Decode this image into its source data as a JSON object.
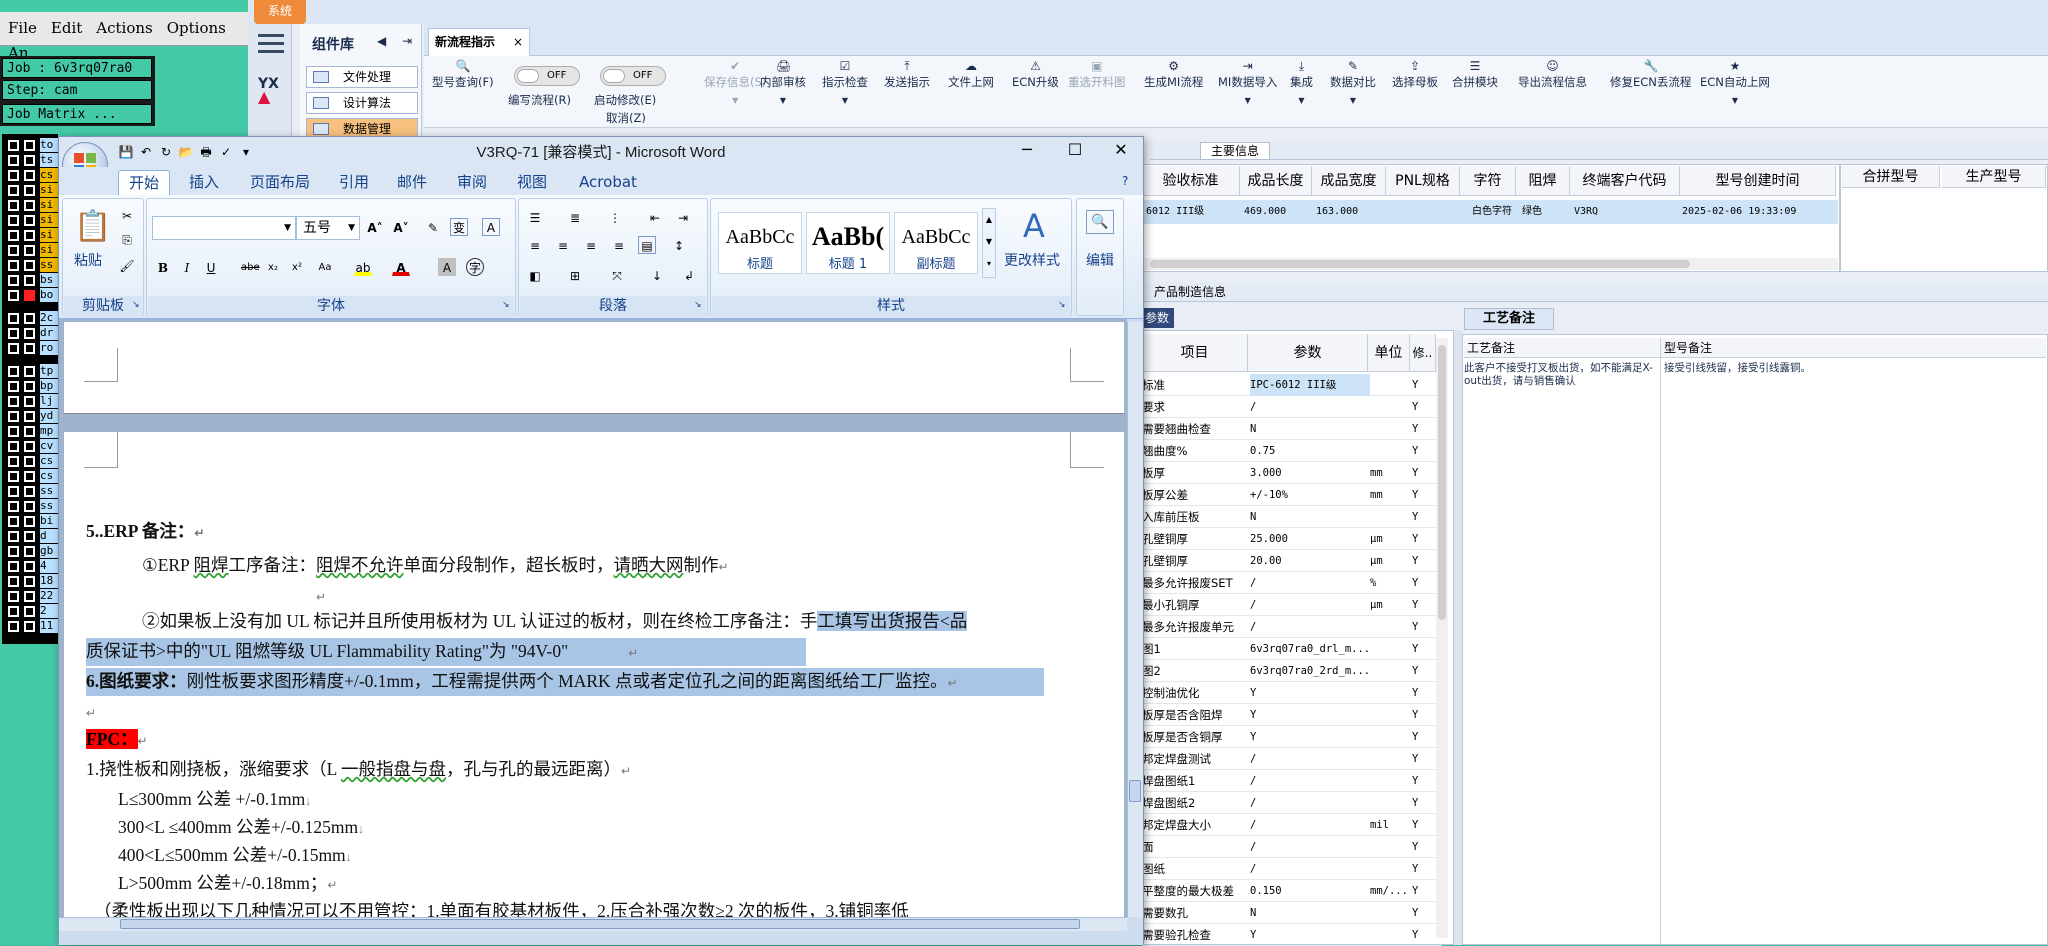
{
  "cam": {
    "menu": [
      "File",
      "Edit",
      "Actions",
      "Options",
      "An"
    ],
    "job_label": "Job : 6v3rq07ra0",
    "step_label": "Step: cam",
    "matrix_button": "Job Matrix ...",
    "layers": [
      {
        "name": "to",
        "color": "#b8e0ff"
      },
      {
        "name": "ts",
        "color": "#b8e0ff"
      },
      {
        "name": "cs",
        "color": "#f0b800"
      },
      {
        "name": "si",
        "color": "#f0b800"
      },
      {
        "name": "si",
        "color": "#f0b800"
      },
      {
        "name": "si",
        "color": "#f0b800"
      },
      {
        "name": "si",
        "color": "#f0b800"
      },
      {
        "name": "si",
        "color": "#f0b800"
      },
      {
        "name": "ss",
        "color": "#f0b800"
      },
      {
        "name": "bs",
        "color": "#b8e0ff"
      },
      {
        "name": "bo",
        "color": "#b8e0ff"
      },
      {
        "name": "2c",
        "color": "#b8e0ff"
      },
      {
        "name": "dr",
        "color": "#b8e0ff"
      },
      {
        "name": "ro",
        "color": "#b8e0ff"
      },
      {
        "name": "tp",
        "color": "#b8e0ff"
      },
      {
        "name": "bp",
        "color": "#b8e0ff"
      },
      {
        "name": "lj",
        "color": "#b8e0ff"
      },
      {
        "name": "yd",
        "color": "#b8e0ff"
      },
      {
        "name": "mp",
        "color": "#b8e0ff"
      },
      {
        "name": "cv",
        "color": "#b8e0ff"
      },
      {
        "name": "cs",
        "color": "#b8e0ff"
      },
      {
        "name": "cs",
        "color": "#b8e0ff"
      },
      {
        "name": "ss",
        "color": "#b8e0ff"
      },
      {
        "name": "ss",
        "color": "#b8e0ff"
      },
      {
        "name": "bi",
        "color": "#b8e0ff"
      },
      {
        "name": "d",
        "color": "#b8e0ff"
      },
      {
        "name": "gb",
        "color": "#b8e0ff"
      },
      {
        "name": "4",
        "color": "#b8e0ff"
      },
      {
        "name": "18",
        "color": "#b8e0ff"
      },
      {
        "name": "22",
        "color": "#b8e0ff"
      },
      {
        "name": "2",
        "color": "#b8e0ff"
      },
      {
        "name": "11",
        "color": "#b8e0ff"
      }
    ]
  },
  "sys": {
    "system_tab": "系统",
    "component_library": "组件库",
    "components": [
      "文件处理",
      "设计算法",
      "数据管理"
    ],
    "doc_tab": "新流程指示",
    "toolbar": [
      {
        "label": "型号查询(F)",
        "icon": "🔍",
        "dropdown": false,
        "disabled": false
      },
      {
        "label": "保存信息(S)",
        "icon": "✔",
        "dropdown": true,
        "disabled": true
      },
      {
        "label": "内部审核",
        "icon": "🖨",
        "dropdown": true,
        "disabled": false
      },
      {
        "label": "指示检查",
        "icon": "☑",
        "dropdown": true,
        "disabled": false
      },
      {
        "label": "发送指示",
        "icon": "⤒",
        "dropdown": false,
        "disabled": false
      },
      {
        "label": "文件上网",
        "icon": "☁",
        "dropdown": false,
        "disabled": false
      },
      {
        "label": "ECN升级",
        "icon": "⚠",
        "dropdown": false,
        "disabled": false
      },
      {
        "label": "重选开料图",
        "icon": "▣",
        "dropdown": false,
        "disabled": true
      },
      {
        "label": "生成MI流程",
        "icon": "⚙",
        "dropdown": false,
        "disabled": false
      },
      {
        "label": "MI数据导入",
        "icon": "⇥",
        "dropdown": true,
        "disabled": false
      },
      {
        "label": "集成",
        "icon": "⤓",
        "dropdown": true,
        "disabled": false
      },
      {
        "label": "数据对比",
        "icon": "✎",
        "dropdown": true,
        "disabled": false
      },
      {
        "label": "选择母板",
        "icon": "⇪",
        "dropdown": false,
        "disabled": false
      },
      {
        "label": "合拼模块",
        "icon": "☰",
        "dropdown": false,
        "disabled": false
      },
      {
        "label": "导出流程信息",
        "icon": "☺",
        "dropdown": false,
        "disabled": false
      },
      {
        "label": "修复ECN丢流程",
        "icon": "🔧",
        "dropdown": false,
        "disabled": false
      },
      {
        "label": "ECN自动上网",
        "icon": "★",
        "dropdown": true,
        "disabled": false
      }
    ],
    "toggle1": {
      "state": "OFF",
      "label": "编写流程(R)"
    },
    "toggle2": {
      "state": "OFF",
      "label": "启动修改(E)",
      "sublabel": "取消(Z)"
    },
    "main_info_tab": "主要信息",
    "main_headers": [
      "验收标准",
      "成品长度",
      "成品宽度",
      "PNL规格",
      "字符",
      "阻焊",
      "终端客户代码",
      "型号创建时间"
    ],
    "main_row": [
      "6012 III级",
      "469.000",
      "163.000",
      "",
      "白色字符",
      "绿色",
      "V3RQ",
      "2025-02-06 19:33:09"
    ],
    "right_headers": [
      "合拼型号",
      "生产型号"
    ],
    "section_title": "产品制造信息",
    "param_tab": "参数",
    "param_headers": [
      "项目",
      "参数",
      "单位",
      "修.."
    ],
    "params": [
      [
        "标准",
        "IPC-6012 III级",
        "",
        "Y"
      ],
      [
        "要求",
        "/",
        "",
        "Y"
      ],
      [
        "需要翘曲检查",
        "N",
        "",
        "Y"
      ],
      [
        "翘曲度%",
        "0.75",
        "",
        "Y"
      ],
      [
        "板厚",
        "3.000",
        "mm",
        "Y"
      ],
      [
        "板厚公差",
        "+/-10%",
        "mm",
        "Y"
      ],
      [
        "入库前压板",
        "N",
        "",
        "Y"
      ],
      [
        "孔壁铜厚",
        "25.000",
        "μm",
        "Y"
      ],
      [
        "孔壁铜厚",
        "20.00",
        "μm",
        "Y"
      ],
      [
        "最多允许报废SET",
        "/",
        "%",
        "Y"
      ],
      [
        "最小孔铜厚",
        "/",
        "μm",
        "Y"
      ],
      [
        "最多允许报废单元",
        "/",
        "",
        "Y"
      ],
      [
        "图1",
        "6v3rq07ra0_drl_m...",
        "",
        "Y"
      ],
      [
        "图2",
        "6v3rq07ra0_2rd_m...",
        "",
        "Y"
      ],
      [
        "控制油优化",
        "Y",
        "",
        "Y"
      ],
      [
        "板厚是否含阻焊",
        "Y",
        "",
        "Y"
      ],
      [
        "板厚是否含铜厚",
        "Y",
        "",
        "Y"
      ],
      [
        "邦定焊盘测试",
        "/",
        "",
        "Y"
      ],
      [
        "焊盘图纸1",
        "/",
        "",
        "Y"
      ],
      [
        "焊盘图纸2",
        "/",
        "",
        "Y"
      ],
      [
        "邦定焊盘大小",
        "/",
        "mil",
        "Y"
      ],
      [
        "面",
        "/",
        "",
        "Y"
      ],
      [
        "图纸",
        "/",
        "",
        "Y"
      ],
      [
        "平整度的最大极差",
        "0.150",
        "mm/...",
        "Y"
      ],
      [
        "需要数孔",
        "N",
        "",
        "Y"
      ],
      [
        "需要验孔检查",
        "Y",
        "",
        "Y"
      ]
    ],
    "craft_tab": "工艺备注",
    "craft_headers": [
      "工艺备注",
      "型号备注"
    ],
    "craft_note": "此客户不接受打叉板出货，如不能满足X-out出货，请与销售确认",
    "model_note": "接受引线残留，接受引线露铜。"
  },
  "word": {
    "title": "V3RQ-71 [兼容模式] - Microsoft Word",
    "tabs": [
      "开始",
      "插入",
      "页面布局",
      "引用",
      "邮件",
      "审阅",
      "视图",
      "Acrobat"
    ],
    "font_name": "",
    "font_size": "五号",
    "groups": [
      "剪贴板",
      "字体",
      "段落",
      "样式"
    ],
    "paste": "粘贴",
    "styles": [
      {
        "sample": "AaBbCc",
        "name": "标题"
      },
      {
        "sample": "AaBb(",
        "name": "标题 1"
      },
      {
        "sample": "AaBbCc",
        "name": "副标题"
      }
    ],
    "change_styles": "更改样式",
    "editing": "编辑",
    "doc": {
      "h5": "5.",
      "h5b": ".ERP 备注：",
      "l1_a": "①ERP ",
      "l1_b": "阻焊",
      "l1_c": "工序备注：",
      "l1_d": "阻焊不允许",
      "l1_e": "单面分段制作，超长板时，",
      "l1_f": "请晒大网",
      "l1_g": "制作",
      "l2_a": "②如果板上没有加 UL 标记并且所使用板材为 UL 认证过的板材，则在终检工序备注：手",
      "l2_b": "工填写出货报告<品",
      "l3": "质保证书>中的\"UL 阻燃等级 UL Flammability Rating\"为 \"94V-0\"",
      "l4_a": "6.图纸要求：",
      "l4_b": "刚性板要求图形精度+/-0.1mm，工程需提供两个 MARK 点或者定位孔之间的距离图纸给工厂监控。",
      "fpc": "FPC：",
      "l5_a": "1.挠性板和刚挠板，涨缩要求（L ",
      "l5_b": "一般指盘与盘",
      "l5_c": "，孔与孔的最远距离）",
      "l6": "L≤300mm 公差 +/-0.1mm",
      "l7": "300<L ≤400mm 公差+/-0.125mm",
      "l8": "400<L≤500mm 公差+/-0.15mm",
      "l9": "L>500mm 公差+/-0.18mm；",
      "l10": "（柔性板出现以下几种情况可以不用管控：1.单面有胶基材板件，2.压合补强次数≥2 次的板件，3.铺铜率低"
    }
  }
}
